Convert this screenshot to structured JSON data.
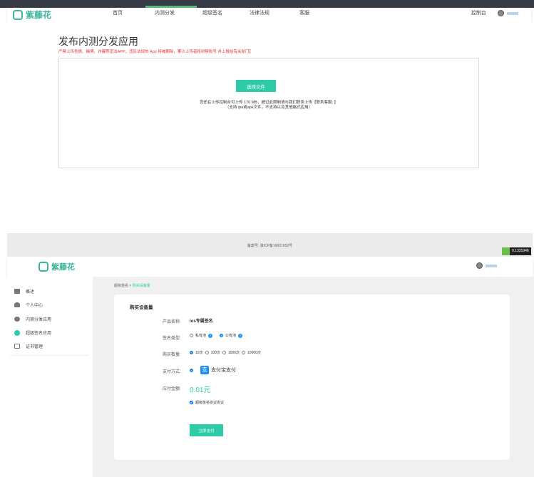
{
  "header1": {
    "brand": "紫藤花",
    "nav": [
      "首页",
      "内测分发",
      "超级签名",
      "法律法规",
      "客服"
    ],
    "active_nav": 1,
    "console": "控制台"
  },
  "upload": {
    "title": "发布内测分发应用",
    "warning": "严禁上传色情、赌博、诈骗等违法APP，违反法规的 App 将被删除，累计上传者将封禁账号 并上报给有关部门】",
    "button": "选择文件",
    "help1": "您还在上传控制台可上传 170 MB，超过此限制请与我们联系上传【联系客服: 】",
    "help2": "（支持 ipa或apk文件，不支持以及其他格式应用）"
  },
  "footer": {
    "icp": "备案号: 滇ICP备16001952号",
    "badge": "0.1331946"
  },
  "header2": {
    "brand": "紫藤花"
  },
  "sidebar": {
    "items": [
      {
        "label": "概述",
        "icon": "monitor-icon"
      },
      {
        "label": "个人中心",
        "icon": "user-icon"
      },
      {
        "label": "内测分发应用",
        "icon": "cube-icon"
      },
      {
        "label": "超级签名应用",
        "icon": "pen-icon"
      },
      {
        "label": "证书管理",
        "icon": "certificate-icon"
      }
    ],
    "active": 3
  },
  "breadcrumb": {
    "parent": "超级签名",
    "sep": ">",
    "current": "购买设备量"
  },
  "form": {
    "title": "购买设备量",
    "product_label": "产品名称:",
    "product_value": "ios专属签名",
    "type_label": "签名类型:",
    "type_options": [
      "私有池",
      "公有池"
    ],
    "type_selected": 1,
    "qty_label": "购买数量:",
    "qty_options": [
      "10次",
      "100次",
      "1000次",
      "10000次"
    ],
    "qty_selected": 0,
    "pay_label": "支付方式:",
    "pay_method": "支付宝支付",
    "amount_label": "应付金额:",
    "amount": "0.01元",
    "agree": "超级签名协议协议",
    "agree_checked": true,
    "submit": "立即支付"
  },
  "colors": {
    "accent": "#2ecba8",
    "topbar": "#363a45",
    "warning": "#ee3333"
  }
}
